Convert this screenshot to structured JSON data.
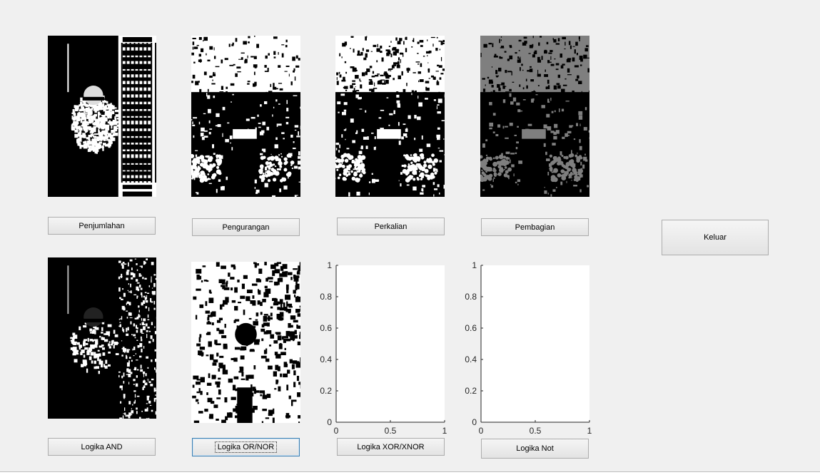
{
  "window": {
    "background": "#f0f0f0"
  },
  "images": [
    {
      "name": "result-image-penjumlahan",
      "scene": "library-portrait-binary"
    },
    {
      "name": "result-image-pengurangan",
      "scene": "trees-binary-light"
    },
    {
      "name": "result-image-perkalian",
      "scene": "trees-binary-dark"
    },
    {
      "name": "result-image-pembagian",
      "scene": "trees-gray"
    },
    {
      "name": "result-image-logika-and",
      "scene": "library-portrait-dark"
    },
    {
      "name": "result-image-logika-or-nor",
      "scene": "portrait-binary-light"
    }
  ],
  "buttons": {
    "penjumlahan": "Penjumlahan",
    "pengurangan": "Pengurangan",
    "perkalian": "Perkalian",
    "pembagian": "Pembagian",
    "keluar": "Keluar",
    "logika_and": "Logika AND",
    "logika_or_nor": "Logika OR/NOR",
    "logika_xor_xnor": "Logika XOR/XNOR",
    "logika_not": "Logika Not"
  },
  "axes": [
    {
      "name": "axes-xor-xnor",
      "xlim": [
        0,
        1
      ],
      "ylim": [
        0,
        1
      ],
      "xticks": [
        "0",
        "0.5",
        "1"
      ],
      "yticks": [
        "0",
        "0.2",
        "0.4",
        "0.6",
        "0.8",
        "1"
      ]
    },
    {
      "name": "axes-logika-not",
      "xlim": [
        0,
        1
      ],
      "ylim": [
        0,
        1
      ],
      "xticks": [
        "0",
        "0.5",
        "1"
      ],
      "yticks": [
        "0",
        "0.2",
        "0.4",
        "0.6",
        "0.8",
        "1"
      ]
    }
  ]
}
